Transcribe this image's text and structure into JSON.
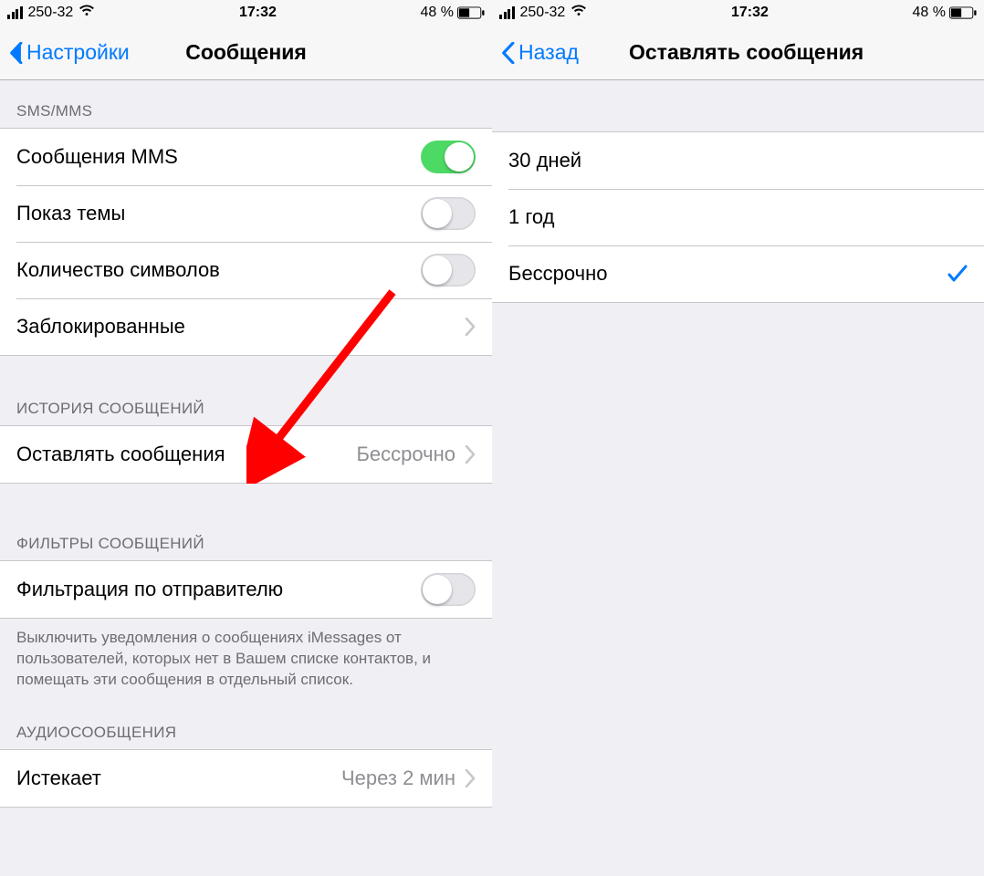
{
  "status": {
    "carrier": "250-32",
    "time": "17:32",
    "battery_text_left": "48 %",
    "battery_text_right": "48 %"
  },
  "colors": {
    "tint": "#007aff",
    "toggle_on": "#4cd964",
    "arrow": "#ff0000"
  },
  "left": {
    "nav": {
      "back": "Настройки",
      "title": "Сообщения"
    },
    "sections": {
      "sms": {
        "header": "SMS/MMS",
        "rows": {
          "mms": {
            "label": "Сообщения MMS",
            "on": true
          },
          "subject": {
            "label": "Показ темы",
            "on": false
          },
          "char_count": {
            "label": "Количество символов",
            "on": false
          },
          "blocked": {
            "label": "Заблокированные"
          }
        }
      },
      "history": {
        "header": "ИСТОРИЯ СООБЩЕНИЙ",
        "rows": {
          "keep": {
            "label": "Оставлять сообщения",
            "value": "Бессрочно"
          }
        }
      },
      "filters": {
        "header": "ФИЛЬТРЫ СООБЩЕНИЙ",
        "rows": {
          "filter_unknown": {
            "label": "Фильтрация по отправителю",
            "on": false
          }
        },
        "footer": "Выключить уведомления о сообщениях iMessages от пользователей, которых нет в Вашем списке контактов, и помещать эти сообщения в отдельный список."
      },
      "audio": {
        "header": "АУДИОСООБЩЕНИЯ",
        "rows": {
          "expire": {
            "label": "Истекает",
            "value": "Через 2 мин"
          }
        }
      }
    }
  },
  "right": {
    "nav": {
      "back": "Назад",
      "title": "Оставлять сообщения"
    },
    "options": [
      {
        "label": "30 дней",
        "selected": false
      },
      {
        "label": "1 год",
        "selected": false
      },
      {
        "label": "Бессрочно",
        "selected": true
      }
    ]
  }
}
